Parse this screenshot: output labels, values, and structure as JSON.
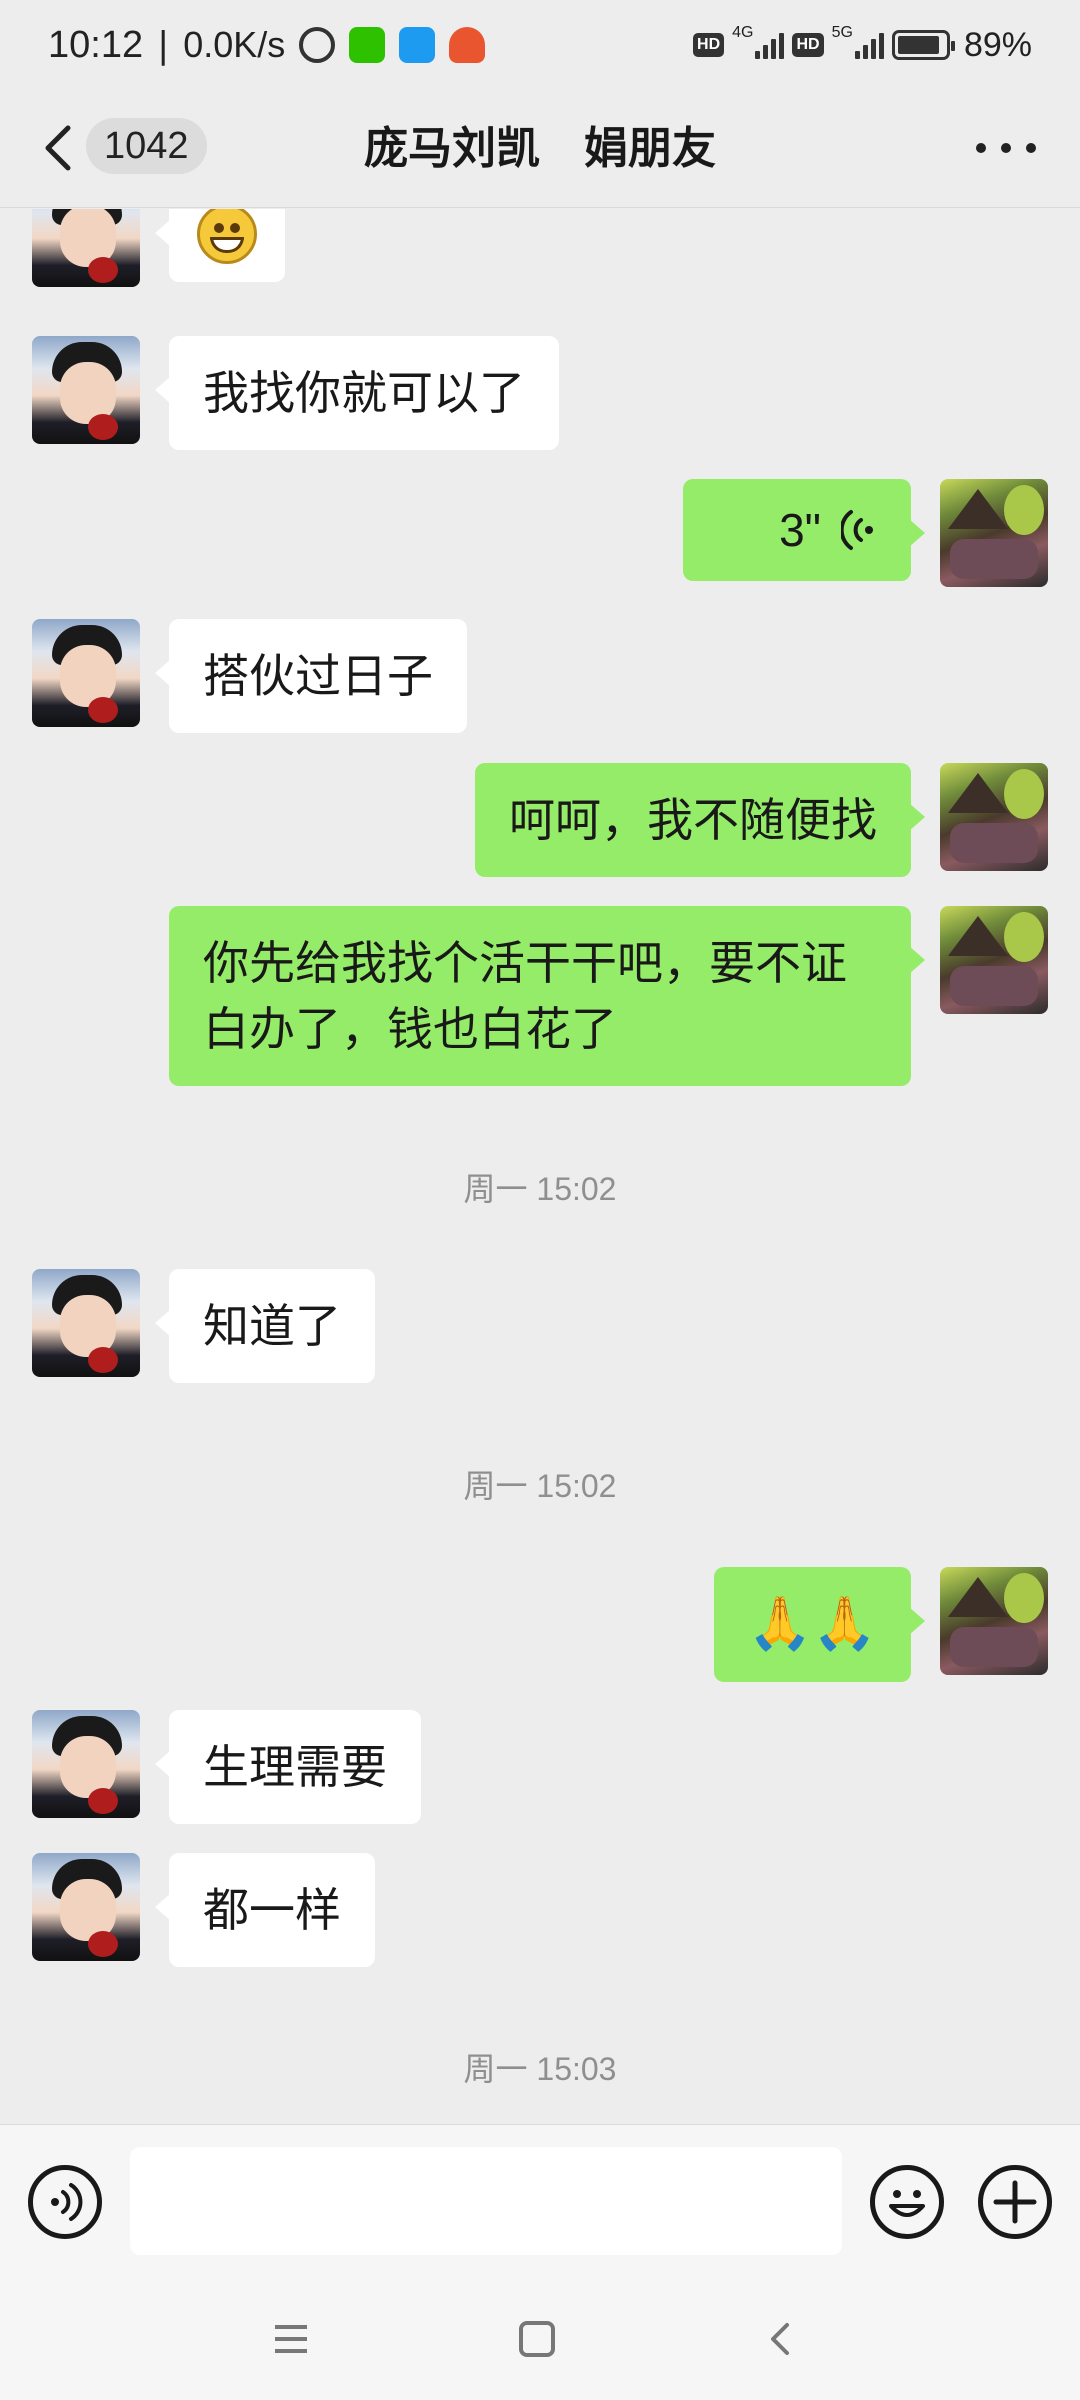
{
  "status_bar": {
    "time": "10:12",
    "speed": "0.0K/s",
    "network_1": "4G",
    "network_2": "5G",
    "hd": "HD",
    "battery_percent": "89%",
    "battery_level": 0.89
  },
  "header": {
    "unread_count": "1042",
    "title": "庞马刘凯　娟朋友"
  },
  "messages": [
    {
      "side": "in",
      "type": "emoji",
      "emoji": "grinning-face-icon"
    },
    {
      "side": "in",
      "type": "text",
      "text": "我找你就可以了"
    },
    {
      "side": "out",
      "type": "voice",
      "duration": "3\""
    },
    {
      "side": "in",
      "type": "text",
      "text": "搭伙过日子"
    },
    {
      "side": "out",
      "type": "text",
      "text": "呵呵，我不随便找"
    },
    {
      "side": "out",
      "type": "text",
      "text": "你先给我找个活干干吧，要不证白办了，钱也白花了"
    },
    {
      "side": "time",
      "text": "周一 15:02"
    },
    {
      "side": "in",
      "type": "text",
      "text": "知道了"
    },
    {
      "side": "time",
      "text": "周一 15:02"
    },
    {
      "side": "out",
      "type": "emoji",
      "text": "🙏🙏"
    },
    {
      "side": "in",
      "type": "text",
      "text": "生理需要"
    },
    {
      "side": "in",
      "type": "text",
      "text": "都一样"
    },
    {
      "side": "time",
      "text": "周一 15:03"
    }
  ],
  "input": {
    "value": "",
    "placeholder": ""
  },
  "colors": {
    "background": "#ededed",
    "outgoing_bubble": "#95ec69",
    "incoming_bubble": "#ffffff",
    "timestamp": "#8f8f8f"
  }
}
